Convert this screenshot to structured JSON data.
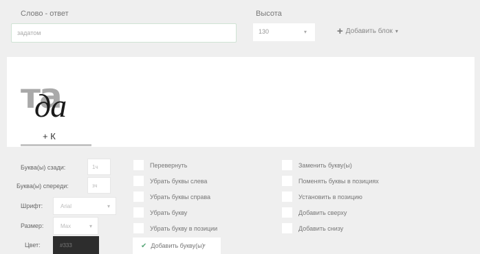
{
  "form": {
    "word_label": "Слово - ответ",
    "word_value": "задатом",
    "height_label": "Высота",
    "height_value": "130",
    "add_block_label": "Добавить блок"
  },
  "preview": {
    "top_glyph": "та",
    "bottom_glyph": "да",
    "suffix": "+ К"
  },
  "settings": {
    "letters_back_label": "Буквa(ы) сзади:",
    "letters_back_value": "1ч",
    "letters_front_label": "Буква(ы) спереди:",
    "letters_front_value": "зч",
    "font_label": "Шрифт:",
    "font_value": "Arial",
    "size_label": "Размер:",
    "size_value": "Max",
    "color_label": "Цвет:",
    "color_value": "#333"
  },
  "options_col1": [
    {
      "label": "Перевернуть",
      "checked": false
    },
    {
      "label": "Убрать буквы слева",
      "checked": false
    },
    {
      "label": "Убрать буквы справа",
      "checked": false
    },
    {
      "label": "Убрать букву",
      "checked": false
    },
    {
      "label": "Убрать букву в позиции",
      "checked": false
    }
  ],
  "add_letter_label": "Добавить букву(ы)",
  "options_col2": [
    {
      "label": "Заменить букву(ы)",
      "checked": false
    },
    {
      "label": "Поменять буквы в позициях",
      "checked": false
    },
    {
      "label": "Установить в позицию",
      "checked": false
    },
    {
      "label": "Добавить сверху",
      "checked": false
    },
    {
      "label": "Добавить снизу",
      "checked": false
    }
  ]
}
